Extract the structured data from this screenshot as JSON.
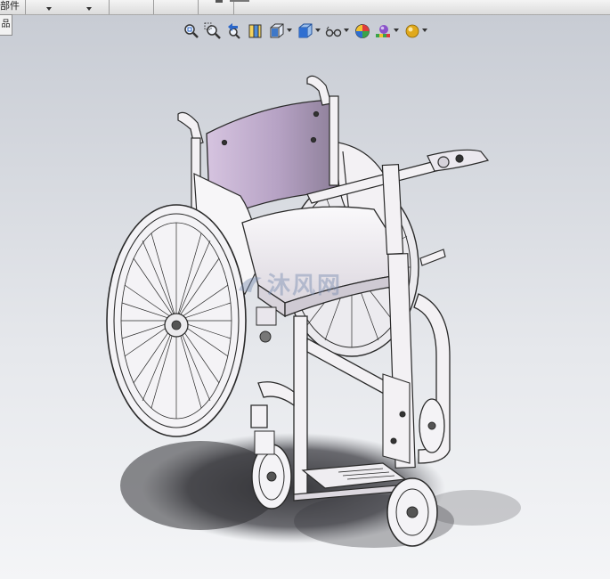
{
  "toolbar": {
    "part_label": "部件",
    "clipped_texts": [
      "",
      "",
      "",
      ""
    ]
  },
  "left_tab": {
    "label": "品"
  },
  "view_toolbar": {
    "buttons": [
      {
        "icon": "zoom-to-fit-icon",
        "has_caret": false
      },
      {
        "icon": "zoom-to-area-icon",
        "has_caret": false
      },
      {
        "icon": "previous-view-icon",
        "has_caret": false
      },
      {
        "icon": "section-view-icon",
        "has_caret": false
      },
      {
        "icon": "view-orientation-icon",
        "has_caret": true
      },
      {
        "icon": "display-style-icon",
        "has_caret": true
      },
      {
        "icon": "hide-show-items-icon",
        "has_caret": true
      },
      {
        "icon": "edit-appearance-icon",
        "has_caret": false
      },
      {
        "icon": "apply-scene-icon",
        "has_caret": true
      },
      {
        "icon": "view-settings-icon",
        "has_caret": true
      }
    ]
  },
  "viewport": {
    "background_top": "#c8ccd4",
    "background_bottom": "#f4f5f7",
    "model": "wheelchair-assembly",
    "watermark_text": "沐风网"
  },
  "colors": {
    "backrest": "#c9b8d4",
    "frame": "#f3f1f4",
    "outline": "#2a2a2a",
    "shadow": "#2f2f33"
  }
}
